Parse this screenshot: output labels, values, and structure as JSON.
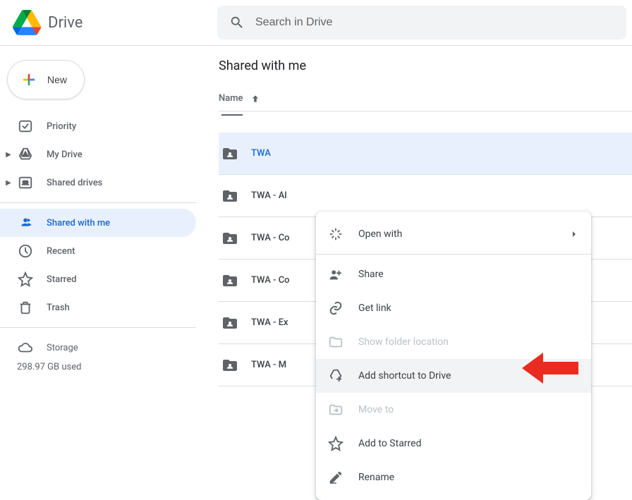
{
  "header": {
    "product_name": "Drive",
    "search_placeholder": "Search in Drive"
  },
  "new_button_label": "New",
  "sidebar": {
    "items": [
      {
        "label": "Priority",
        "icon": "priority-icon",
        "expandable": false
      },
      {
        "label": "My Drive",
        "icon": "my-drive-icon",
        "expandable": true
      },
      {
        "label": "Shared drives",
        "icon": "shared-drives-icon",
        "expandable": true
      },
      {
        "label": "Shared with me",
        "icon": "shared-with-me-icon",
        "expandable": false,
        "active": true
      },
      {
        "label": "Recent",
        "icon": "recent-icon",
        "expandable": false
      },
      {
        "label": "Starred",
        "icon": "starred-icon",
        "expandable": false
      },
      {
        "label": "Trash",
        "icon": "trash-icon",
        "expandable": false
      }
    ],
    "storage_label": "Storage",
    "storage_used": "298.97 GB used"
  },
  "main": {
    "title": "Shared with me",
    "column_header": "Name",
    "files": [
      {
        "name": "TWA",
        "selected": true
      },
      {
        "name": "TWA - Al"
      },
      {
        "name": "TWA - Co"
      },
      {
        "name": "TWA - Co"
      },
      {
        "name": "TWA - Ex"
      },
      {
        "name": "TWA - M"
      }
    ]
  },
  "context_menu": {
    "items": [
      {
        "label": "Open with",
        "icon": "open-with-icon",
        "submenu": true
      },
      {
        "sep": true
      },
      {
        "label": "Share",
        "icon": "share-icon"
      },
      {
        "label": "Get link",
        "icon": "link-icon"
      },
      {
        "label": "Show folder location",
        "icon": "folder-outline-icon",
        "disabled": true
      },
      {
        "label": "Add shortcut to Drive",
        "icon": "add-shortcut-icon",
        "highlighted": true
      },
      {
        "label": "Move to",
        "icon": "move-to-icon",
        "disabled": true
      },
      {
        "label": "Add to Starred",
        "icon": "star-outline-icon"
      },
      {
        "label": "Rename",
        "icon": "rename-icon"
      }
    ]
  }
}
